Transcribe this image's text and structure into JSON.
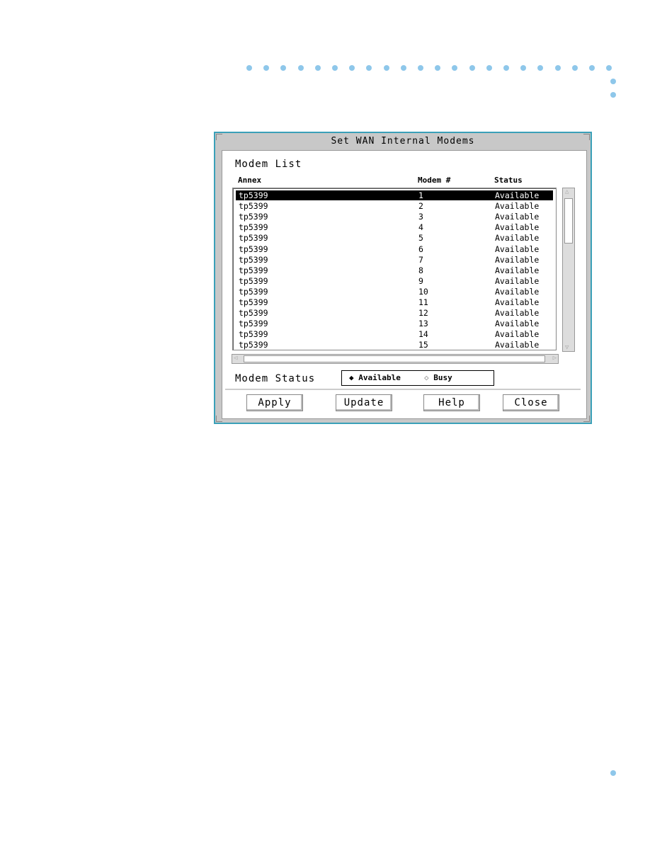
{
  "decor": {
    "dot_color": "#8ec7ea"
  },
  "dialog": {
    "title": "Set WAN Internal Modems",
    "list_label": "Modem List",
    "columns": [
      "Annex",
      "Modem #",
      "Status"
    ],
    "rows": [
      [
        "tp5399",
        "1",
        "Available"
      ],
      [
        "tp5399",
        "2",
        "Available"
      ],
      [
        "tp5399",
        "3",
        "Available"
      ],
      [
        "tp5399",
        "4",
        "Available"
      ],
      [
        "tp5399",
        "5",
        "Available"
      ],
      [
        "tp5399",
        "6",
        "Available"
      ],
      [
        "tp5399",
        "7",
        "Available"
      ],
      [
        "tp5399",
        "8",
        "Available"
      ],
      [
        "tp5399",
        "9",
        "Available"
      ],
      [
        "tp5399",
        "10",
        "Available"
      ],
      [
        "tp5399",
        "11",
        "Available"
      ],
      [
        "tp5399",
        "12",
        "Available"
      ],
      [
        "tp5399",
        "13",
        "Available"
      ],
      [
        "tp5399",
        "14",
        "Available"
      ],
      [
        "tp5399",
        "15",
        "Available"
      ]
    ],
    "selected_row": 0,
    "status_label": "Modem Status",
    "status_options": [
      "Available",
      "Busy"
    ],
    "status_selected": "Available",
    "buttons": {
      "apply": "Apply",
      "update": "Update",
      "help": "Help",
      "close": "Close"
    }
  }
}
